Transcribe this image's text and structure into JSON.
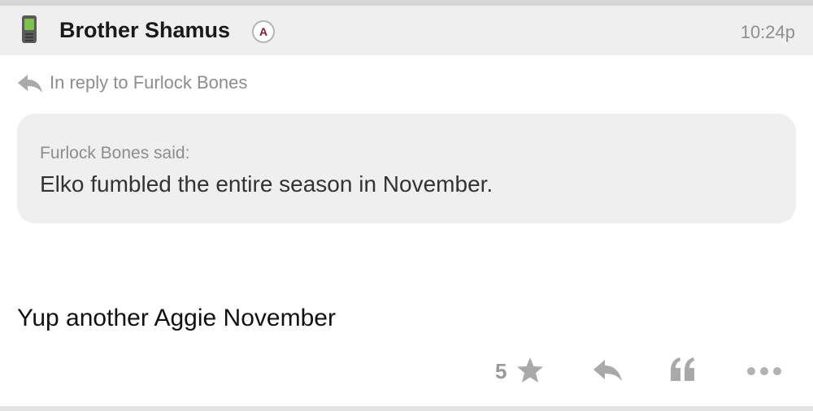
{
  "post": {
    "author": "Brother Shamus",
    "badge_letter": "A",
    "timestamp": "10:24p",
    "reply_to": "In reply to Furlock Bones",
    "quote": {
      "author_line": "Furlock Bones said:",
      "text": "Elko fumbled the entire season in November."
    },
    "body": "Yup another Aggie November",
    "like_count": "5"
  },
  "colors": {
    "header_bg": "#efefef",
    "quote_bg": "#efefef",
    "badge_letter": "#7a1f2b",
    "muted_text": "#8d8d8d",
    "icon_gray": "#a9a9a9"
  },
  "icons": {
    "device": "mobile-phone-icon",
    "reply": "reply-arrow-icon",
    "star": "star-icon",
    "quote": "quote-icon",
    "more": "more-dots-icon"
  }
}
